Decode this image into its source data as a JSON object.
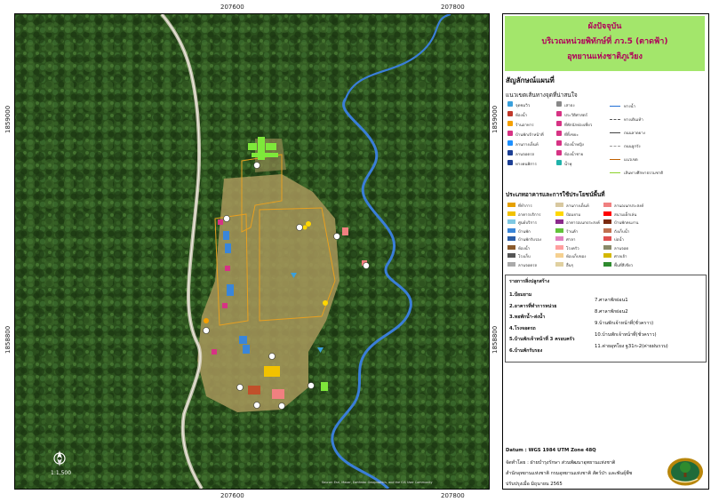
{
  "grid": {
    "x_labels": [
      "207600",
      "207800"
    ],
    "y_labels": [
      "1859000",
      "1858800"
    ]
  },
  "title": {
    "line1": "ผังปัจจุบัน",
    "line2": "บริเวณหน่วยพิทักษ์ที่ ภว.5 (ตาดฟ้า)",
    "line3": "อุทยานแห่งชาติภูเวียง"
  },
  "legend": {
    "heading": "สัญลักษณ์แผนที่",
    "subheading": "แนวเขตเส้นทางจุดที่น่าสนใจ",
    "symbols": [
      {
        "label": "จุดชมวิว",
        "color": "#3aa0dc"
      },
      {
        "label": "ห้องน้ำ",
        "color": "#c0392b"
      },
      {
        "label": "ร้านอาหาร",
        "color": "#f5a000"
      },
      {
        "label": "บ้านพักเจ้าหน้าที่",
        "color": "#d63384"
      },
      {
        "label": "ลานกางเต็นท์",
        "color": "#1e90ff"
      },
      {
        "label": "ลานจอดรถ",
        "color": "#1c3f94"
      },
      {
        "label": "ทางคนพิการ",
        "color": "#1c3f94"
      },
      {
        "label": "เสาธง",
        "color": "#888888"
      },
      {
        "label": "ประวัติศาสตร์",
        "color": "#d63384"
      },
      {
        "label": "ที่พักนักท่องเที่ยว",
        "color": "#d63384"
      },
      {
        "label": "ที่ทิ้งขยะ",
        "color": "#d63384"
      },
      {
        "label": "ห้องน้ำหญิง",
        "color": "#d63384"
      },
      {
        "label": "ห้องน้ำชาย",
        "color": "#d63384"
      },
      {
        "label": "น้ำพุ",
        "color": "#20b2aa"
      }
    ],
    "lines": [
      {
        "label": "ทางน้ำ",
        "color": "#1f6fd6"
      },
      {
        "label": "ทางเดินเท้า",
        "color": "#555555"
      },
      {
        "label": "ถนนลาดยาง",
        "color": "#444444"
      },
      {
        "label": "ถนนลูกรัง",
        "color": "#999999"
      },
      {
        "label": "แนวเขต",
        "color": "#c06000"
      },
      {
        "label": "เส้นทางศึกษาธรรมชาติ",
        "color": "#8bd22a"
      }
    ],
    "landuse_heading": "ประเภทอาคารและการใช้ประโยชน์พื้นที่",
    "landuse": [
      {
        "label": "ที่ทำการ",
        "color": "#e6a100"
      },
      {
        "label": "อาคารบริการ",
        "color": "#f2c200"
      },
      {
        "label": "ศูนย์บริการ",
        "color": "#7ec8e3"
      },
      {
        "label": "บ้านพัก",
        "color": "#3a86d9"
      },
      {
        "label": "บ้านพักรับรอง",
        "color": "#2c5ea8"
      },
      {
        "label": "ห้องน้ำ",
        "color": "#8b5a2b"
      },
      {
        "label": "โรงเก็บ",
        "color": "#555555"
      },
      {
        "label": "ลานจอดรถ",
        "color": "#aaaaaa"
      },
      {
        "label": "ลานกางเต็นท์",
        "color": "#d8c8a0"
      },
      {
        "label": "ป้อมยาม",
        "color": "#ffd700"
      },
      {
        "label": "อาคารอเนกประสงค์",
        "color": "#8b2a8b"
      },
      {
        "label": "ร้านค้า",
        "color": "#62c23a"
      },
      {
        "label": "ศาลา",
        "color": "#e080c0"
      },
      {
        "label": "โรงครัว",
        "color": "#ff9f9f"
      },
      {
        "label": "ห้องเก็บของ",
        "color": "#f5d090"
      },
      {
        "label": "อื่นๆ",
        "color": "#e0d0a0"
      },
      {
        "label": "ลานอเนกประสงค์",
        "color": "#f08080"
      },
      {
        "label": "สนามเด็กเล่น",
        "color": "#ff0000"
      },
      {
        "label": "บ้านพักคนงาน",
        "color": "#7a2a10"
      },
      {
        "label": "ถังเก็บน้ำ",
        "color": "#c07050"
      },
      {
        "label": "บ่อน้ำ",
        "color": "#e05050"
      },
      {
        "label": "ลานจอด",
        "color": "#8a8a6a"
      },
      {
        "label": "ศาลเจ้า",
        "color": "#d4b800"
      },
      {
        "label": "พื้นที่สีเขียว",
        "color": "#2e8b2e"
      }
    ]
  },
  "buildings": {
    "heading": "รายการสิ่งปลูกสร้าง",
    "left": [
      "1.ป้อมยาม",
      "2.อาคารที่ทำการหน่วย",
      "3.หอพักน้ำ-ส่งน้ำ",
      "4.โรงจอดรถ",
      "5.บ้านพักเจ้าหน้าที่ 3 ครอบครัว",
      "6.บ้านพักรับรอง"
    ],
    "right": [
      "7.ศาลาพักผ่อน1",
      "8.ศาลาพักผ่อน2",
      "9.บ้านพักเจ้าหน้าที่(ชั่วคราว)",
      "10.บ้านพักเจ้าหน้าที่(ชั่วคราว)",
      "11.ค่ายอุทโยง ฐ31ก-2(ค่ายฝนรวบ)"
    ]
  },
  "footer": {
    "datum": "Datum : WGS 1984 UTM Zone 48Q",
    "made_by": "จัดทำโดย : ฝ่ายบำรุงรักษา ส่วนพัฒนาอุทยานแห่งชาติ",
    "org": "สำนักอุทยานแห่งชาติ กรมอุทยานแห่งชาติ สัตว์ป่า และพันธุ์พืช",
    "updated": "ปรับปรุงเมื่อ มิถุนายน 2565"
  },
  "scale": {
    "label": "1:1,500"
  },
  "attribution": "Source: Esri, Maxar, Earthstar Geographics, and the GIS User Community",
  "colors": {
    "forest_dark": "#1e3a14",
    "forest": "#2f5a20",
    "clearing": "#a89a5a",
    "river": "#3a7ed8",
    "boundary": "#e8a020",
    "road": "#d8d0c0",
    "title_bg": "#a3e66b",
    "title_text": "#b0005a"
  }
}
